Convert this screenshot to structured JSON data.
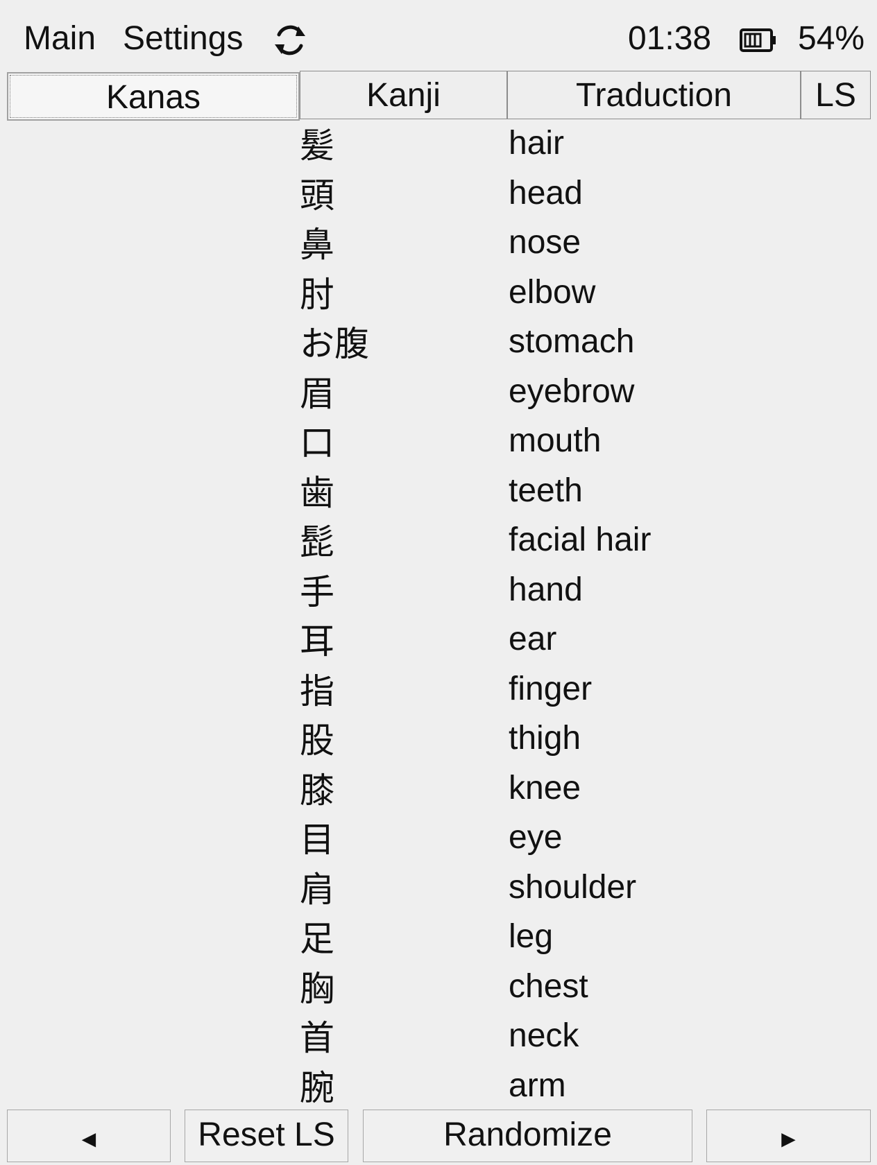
{
  "menu": {
    "main_label": "Main",
    "settings_label": "Settings",
    "refresh_icon": "refresh-icon"
  },
  "status": {
    "time": "01:38",
    "battery_icon": "battery-icon",
    "battery_percent": "54%",
    "battery_level": 0.54
  },
  "tabs": [
    {
      "label": "Kanas",
      "active": true
    },
    {
      "label": "Kanji",
      "active": false
    },
    {
      "label": "Traduction",
      "active": false
    },
    {
      "label": "LS",
      "active": false
    }
  ],
  "rows": [
    {
      "kanji": "髪",
      "translation": "hair"
    },
    {
      "kanji": "頭",
      "translation": "head"
    },
    {
      "kanji": "鼻",
      "translation": "nose"
    },
    {
      "kanji": "肘",
      "translation": "elbow"
    },
    {
      "kanji": "お腹",
      "translation": "stomach"
    },
    {
      "kanji": "眉",
      "translation": "eyebrow"
    },
    {
      "kanji": "口",
      "translation": "mouth"
    },
    {
      "kanji": "歯",
      "translation": "teeth"
    },
    {
      "kanji": "髭",
      "translation": "facial hair"
    },
    {
      "kanji": "手",
      "translation": "hand"
    },
    {
      "kanji": "耳",
      "translation": "ear"
    },
    {
      "kanji": "指",
      "translation": "finger"
    },
    {
      "kanji": "股",
      "translation": "thigh"
    },
    {
      "kanji": "膝",
      "translation": "knee"
    },
    {
      "kanji": "目",
      "translation": "eye"
    },
    {
      "kanji": "肩",
      "translation": "shoulder"
    },
    {
      "kanji": "足",
      "translation": "leg"
    },
    {
      "kanji": "胸",
      "translation": "chest"
    },
    {
      "kanji": "首",
      "translation": "neck"
    },
    {
      "kanji": "腕",
      "translation": "arm"
    }
  ],
  "buttons": {
    "prev_label": "◄",
    "reset_label": "Reset LS",
    "randomize_label": "Randomize",
    "next_label": "►"
  }
}
